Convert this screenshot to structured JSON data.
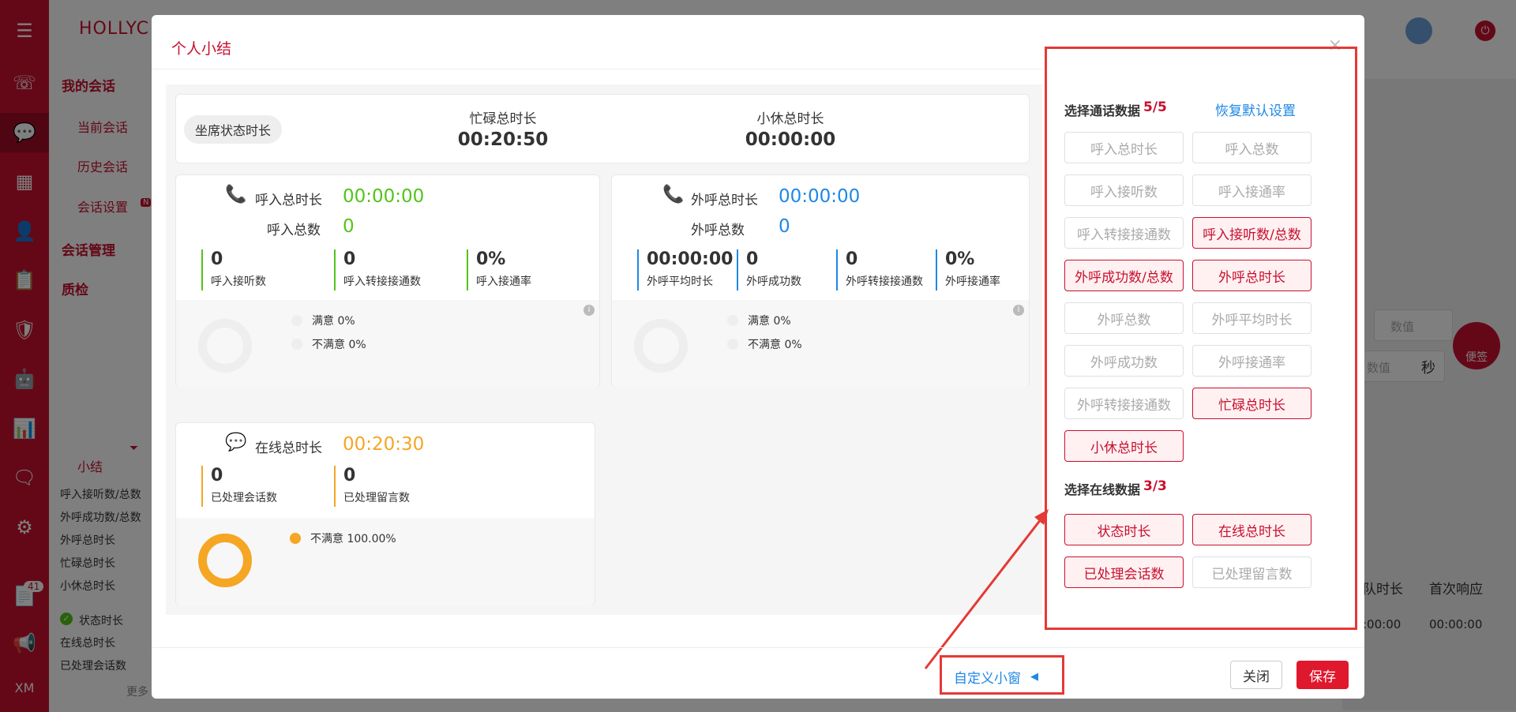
{
  "app": {
    "brand": "HOLLYC",
    "nav": {
      "my_sessions": "我的会话",
      "current": "当前会话",
      "history": "历史会话",
      "settings": "会话设置",
      "session_mgmt": "会话管理",
      "qc": "质检"
    },
    "new_badge": "N",
    "summary": {
      "title": "小结",
      "items": [
        "呼入接听数/总数",
        "外呼成功数/总数",
        "外呼总时长",
        "忙碌总时长",
        "小休总时长"
      ],
      "online_items": [
        "状态时长",
        "在线总时长",
        "已处理会话数"
      ],
      "more": "更多"
    },
    "rail_badge": "41",
    "rail_footer": "XM",
    "bookmark": "便签",
    "sec_unit": "秒",
    "table_headers": [
      "队时长",
      "首次响应"
    ],
    "table_values": [
      ":00:00",
      "00:00:00"
    ],
    "value_placeholders": [
      "数值",
      "数值"
    ]
  },
  "modal": {
    "title": "个人小结",
    "close": "×"
  },
  "status": {
    "pill": "坐席状态时长",
    "busy_label": "忙碌总时长",
    "busy_value": "00:20:50",
    "rest_label": "小休总时长",
    "rest_value": "00:00:00"
  },
  "inbound": {
    "total_label": "呼入总时长",
    "total_value": "00:00:00",
    "count_label": "呼入总数",
    "count_value": "0",
    "metrics": [
      {
        "value": "0",
        "label": "呼入接听数"
      },
      {
        "value": "0",
        "label": "呼入转接接通数"
      },
      {
        "value": "0%",
        "label": "呼入接通率"
      }
    ],
    "legend": [
      "满意 0%",
      "不满意 0%"
    ]
  },
  "outbound": {
    "total_label": "外呼总时长",
    "total_value": "00:00:00",
    "count_label": "外呼总数",
    "count_value": "0",
    "metrics": [
      {
        "value": "00:00:00",
        "label": "外呼平均时长"
      },
      {
        "value": "0",
        "label": "外呼成功数"
      },
      {
        "value": "0",
        "label": "外呼转接接通数"
      },
      {
        "value": "0%",
        "label": "外呼接通率"
      }
    ],
    "legend": [
      "满意 0%",
      "不满意 0%"
    ]
  },
  "online": {
    "total_label": "在线总时长",
    "total_value": "00:20:30",
    "metrics": [
      {
        "value": "0",
        "label": "已处理会话数"
      },
      {
        "value": "0",
        "label": "已处理留言数"
      }
    ],
    "legend": [
      "不满意 100.00%"
    ],
    "unsatisfied_fraction": 1.0
  },
  "settings": {
    "call_title": "选择通话数据",
    "call_count": "5/5",
    "reset": "恢复默认设置",
    "call_options": [
      {
        "label": "呼入总时长",
        "selected": false
      },
      {
        "label": "呼入总数",
        "selected": false
      },
      {
        "label": "呼入接听数",
        "selected": false
      },
      {
        "label": "呼入接通率",
        "selected": false
      },
      {
        "label": "呼入转接接通数",
        "selected": false
      },
      {
        "label": "呼入接听数/总数",
        "selected": true
      },
      {
        "label": "外呼成功数/总数",
        "selected": true
      },
      {
        "label": "外呼总时长",
        "selected": true
      },
      {
        "label": "外呼总数",
        "selected": false
      },
      {
        "label": "外呼平均时长",
        "selected": false
      },
      {
        "label": "外呼成功数",
        "selected": false
      },
      {
        "label": "外呼接通率",
        "selected": false
      },
      {
        "label": "外呼转接接通数",
        "selected": false
      },
      {
        "label": "忙碌总时长",
        "selected": true
      },
      {
        "label": "小休总时长",
        "selected": true
      }
    ],
    "online_title": "选择在线数据",
    "online_count": "3/3",
    "online_options": [
      {
        "label": "状态时长",
        "selected": true
      },
      {
        "label": "在线总时长",
        "selected": true
      },
      {
        "label": "已处理会话数",
        "selected": true
      },
      {
        "label": "已处理留言数",
        "selected": false
      }
    ]
  },
  "footer": {
    "customize": "自定义小窗",
    "close": "关闭",
    "save": "保存"
  },
  "colors": {
    "brand": "#c8102e",
    "green": "#52c41a",
    "blue": "#1e88e5",
    "orange": "#f5a623"
  }
}
